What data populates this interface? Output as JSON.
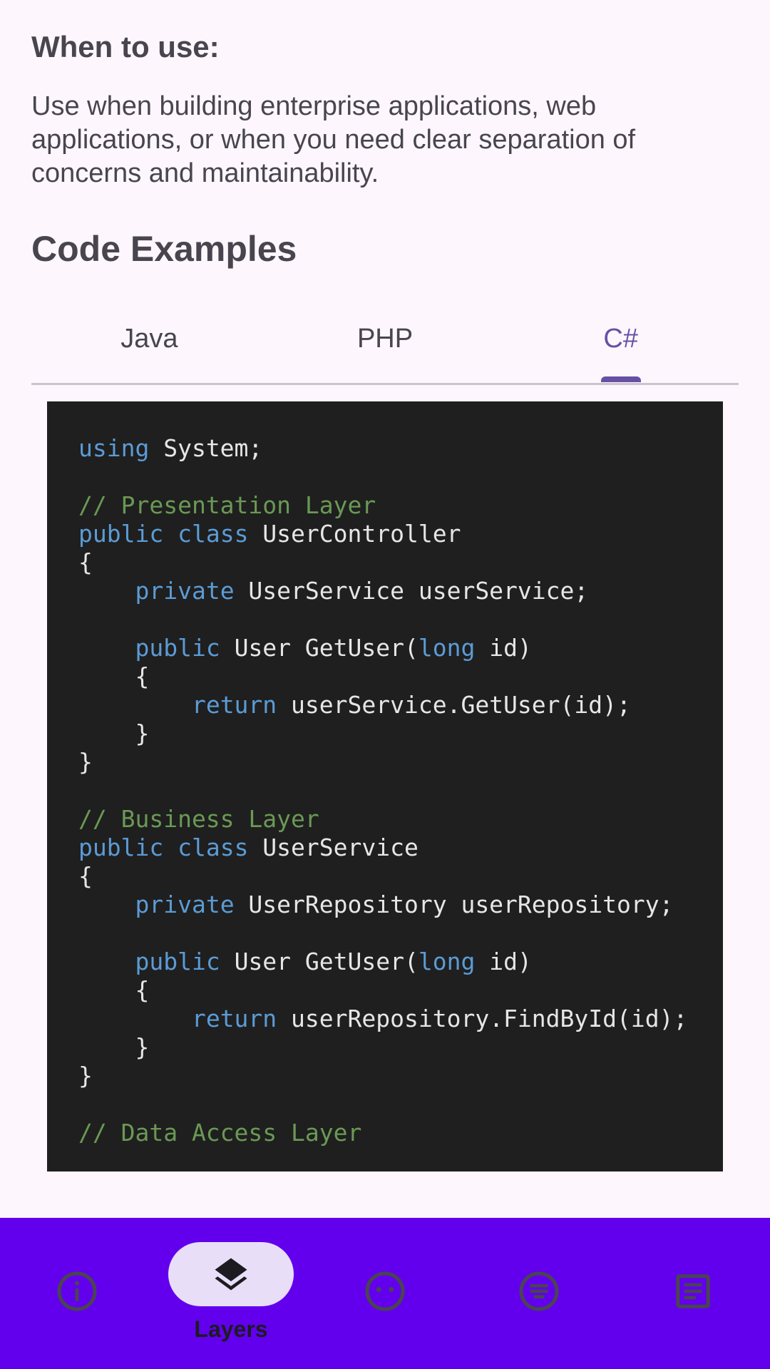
{
  "when_to_use": {
    "title": "When to use:",
    "body": "Use when building enterprise applications, web applications, or when you need clear separation of concerns and maintainability."
  },
  "code_examples": {
    "title": "Code Examples",
    "tabs": [
      {
        "label": "Java",
        "active": false
      },
      {
        "label": "PHP",
        "active": false
      },
      {
        "label": "C#",
        "active": true
      }
    ],
    "code_lines": [
      [
        {
          "t": "using",
          "c": "kw"
        },
        {
          "t": " System;"
        }
      ],
      [],
      [
        {
          "t": "// Presentation Layer",
          "c": "cm"
        }
      ],
      [
        {
          "t": "public",
          "c": "kw"
        },
        {
          "t": " "
        },
        {
          "t": "class",
          "c": "kw"
        },
        {
          "t": " UserController"
        }
      ],
      [
        {
          "t": "{"
        }
      ],
      [
        {
          "t": "    "
        },
        {
          "t": "private",
          "c": "kw"
        },
        {
          "t": " UserService userService;"
        }
      ],
      [],
      [
        {
          "t": "    "
        },
        {
          "t": "public",
          "c": "kw"
        },
        {
          "t": " User GetUser("
        },
        {
          "t": "long",
          "c": "kw"
        },
        {
          "t": " id)"
        }
      ],
      [
        {
          "t": "    {"
        }
      ],
      [
        {
          "t": "        "
        },
        {
          "t": "return",
          "c": "kw"
        },
        {
          "t": " userService.GetUser(id);"
        }
      ],
      [
        {
          "t": "    }"
        }
      ],
      [
        {
          "t": "}"
        }
      ],
      [],
      [
        {
          "t": "// Business Layer",
          "c": "cm"
        }
      ],
      [
        {
          "t": "public",
          "c": "kw"
        },
        {
          "t": " "
        },
        {
          "t": "class",
          "c": "kw"
        },
        {
          "t": " UserService"
        }
      ],
      [
        {
          "t": "{"
        }
      ],
      [
        {
          "t": "    "
        },
        {
          "t": "private",
          "c": "kw"
        },
        {
          "t": " UserRepository userRepository;"
        }
      ],
      [],
      [
        {
          "t": "    "
        },
        {
          "t": "public",
          "c": "kw"
        },
        {
          "t": " User GetUser("
        },
        {
          "t": "long",
          "c": "kw"
        },
        {
          "t": " id)"
        }
      ],
      [
        {
          "t": "    {"
        }
      ],
      [
        {
          "t": "        "
        },
        {
          "t": "return",
          "c": "kw"
        },
        {
          "t": " userRepository.FindById(id);"
        }
      ],
      [
        {
          "t": "    }"
        }
      ],
      [
        {
          "t": "}"
        }
      ],
      [],
      [
        {
          "t": "// Data Access Layer",
          "c": "cm"
        }
      ]
    ]
  },
  "bottom_nav": {
    "items": [
      {
        "icon": "info-icon",
        "label": "",
        "active": false
      },
      {
        "icon": "layers-icon",
        "label": "Layers",
        "active": true
      },
      {
        "icon": "face-icon",
        "label": "",
        "active": false
      },
      {
        "icon": "list-circle-icon",
        "label": "",
        "active": false
      },
      {
        "icon": "article-icon",
        "label": "",
        "active": false
      }
    ]
  },
  "colors": {
    "background": "#fdf7fd",
    "accent": "#6750a4",
    "nav_background": "#6200ee",
    "nav_pill": "#e8def8",
    "code_background": "#1f1f1f",
    "keyword": "#5b9bd5",
    "comment": "#6a9955"
  }
}
